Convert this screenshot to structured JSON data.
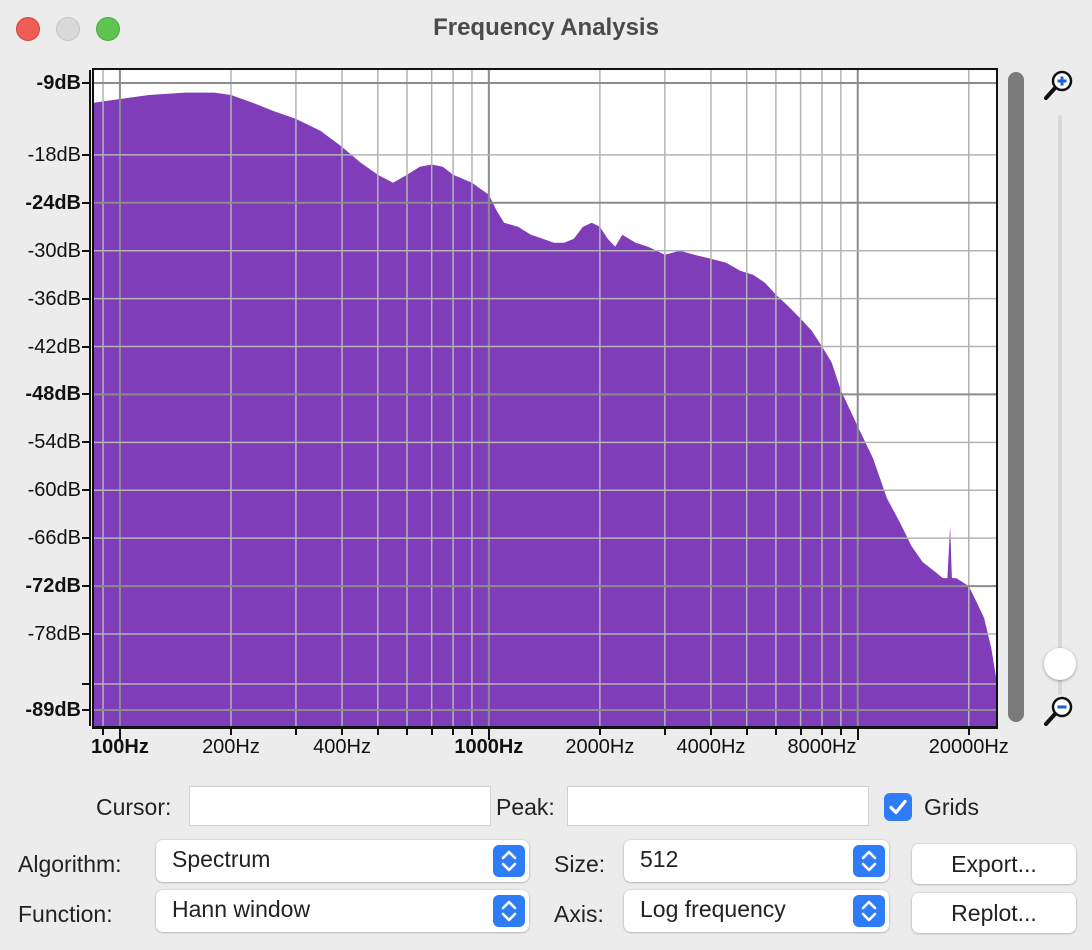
{
  "window": {
    "title": "Frequency Analysis"
  },
  "plot": {
    "y_labels": [
      {
        "text": "-9dB",
        "bold": true,
        "db": -9
      },
      {
        "text": "-18dB",
        "bold": false,
        "db": -18
      },
      {
        "text": "-24dB",
        "bold": true,
        "db": -24
      },
      {
        "text": "-30dB",
        "bold": false,
        "db": -30
      },
      {
        "text": "-36dB",
        "bold": false,
        "db": -36
      },
      {
        "text": "-42dB",
        "bold": false,
        "db": -42
      },
      {
        "text": "-48dB",
        "bold": true,
        "db": -48
      },
      {
        "text": "-54dB",
        "bold": false,
        "db": -54
      },
      {
        "text": "-60dB",
        "bold": false,
        "db": -60
      },
      {
        "text": "-66dB",
        "bold": false,
        "db": -66
      },
      {
        "text": "-72dB",
        "bold": true,
        "db": -72
      },
      {
        "text": "-78dB",
        "bold": false,
        "db": -78
      },
      {
        "text": "-89dB",
        "bold": true,
        "db": -89
      }
    ],
    "x_labels": [
      {
        "text": "100Hz",
        "bold": true,
        "hz": 100
      },
      {
        "text": "200Hz",
        "bold": false,
        "hz": 200
      },
      {
        "text": "400Hz",
        "bold": false,
        "hz": 400
      },
      {
        "text": "1000Hz",
        "bold": true,
        "hz": 1000
      },
      {
        "text": "2000Hz",
        "bold": false,
        "hz": 2000
      },
      {
        "text": "4000Hz",
        "bold": false,
        "hz": 4000
      },
      {
        "text": "8000Hz",
        "bold": false,
        "hz": 8000
      },
      {
        "text": "20000Hz",
        "bold": false,
        "hz": 20000
      }
    ],
    "fill_color": "#7f3db9",
    "grid_color": "#b4b4b4",
    "major_grid_color": "#8c8c8c"
  },
  "chart_data": {
    "type": "area",
    "xscale": "log",
    "xlim": [
      84,
      24000
    ],
    "ylim": [
      -89,
      -9
    ],
    "grid": true,
    "x": [
      84,
      100,
      120,
      150,
      180,
      200,
      230,
      260,
      300,
      350,
      400,
      450,
      500,
      550,
      600,
      650,
      700,
      750,
      800,
      900,
      1000,
      1050,
      1100,
      1200,
      1300,
      1400,
      1500,
      1600,
      1700,
      1800,
      1900,
      2000,
      2100,
      2200,
      2300,
      2500,
      2700,
      3000,
      3300,
      3600,
      4000,
      4400,
      4800,
      5200,
      5600,
      6000,
      6500,
      7000,
      7500,
      8000,
      8500,
      9000,
      10000,
      11000,
      12000,
      13000,
      14000,
      15000,
      16000,
      17000,
      17500,
      17800,
      18000,
      18500,
      20000,
      21000,
      22000,
      23000,
      24000
    ],
    "y": [
      -11.5,
      -11,
      -10.5,
      -10.2,
      -10.2,
      -10.5,
      -11.5,
      -12.5,
      -13.5,
      -15,
      -17,
      -19,
      -20.5,
      -21.5,
      -20.5,
      -19.5,
      -19.2,
      -19.5,
      -20.5,
      -21.5,
      -23,
      -25,
      -26.5,
      -27,
      -28,
      -28.5,
      -29,
      -29,
      -28.5,
      -27,
      -26.5,
      -27,
      -28.5,
      -29.5,
      -28,
      -29,
      -29.5,
      -30.5,
      -30,
      -30.5,
      -31,
      -31.5,
      -32.5,
      -33,
      -34,
      -35.5,
      -37,
      -38.5,
      -40,
      -42,
      -44,
      -47.5,
      -52,
      -56,
      -61,
      -64,
      -67,
      -69,
      -70,
      -71,
      -71,
      -64.5,
      -71,
      -71,
      -72,
      -74,
      -76,
      -80,
      -86
    ]
  },
  "controls": {
    "cursor_label": "Cursor:",
    "cursor_value": "",
    "peak_label": "Peak:",
    "peak_value": "",
    "grids_label": "Grids",
    "grids_checked": true,
    "algorithm_label": "Algorithm:",
    "algorithm_value": "Spectrum",
    "function_label": "Function:",
    "function_value": "Hann window",
    "size_label": "Size:",
    "size_value": "512",
    "axis_label": "Axis:",
    "axis_value": "Log frequency",
    "export_label": "Export...",
    "replot_label": "Replot..."
  },
  "icons": {
    "zoom_in": "zoom-in-magnifier",
    "zoom_out": "zoom-out-magnifier",
    "checkmark": "checkmark",
    "select_arrows": "up-down-chevrons"
  },
  "colors": {
    "accent": "#2e7cf6",
    "close": "#ee5d56",
    "maximize": "#5fc452"
  }
}
